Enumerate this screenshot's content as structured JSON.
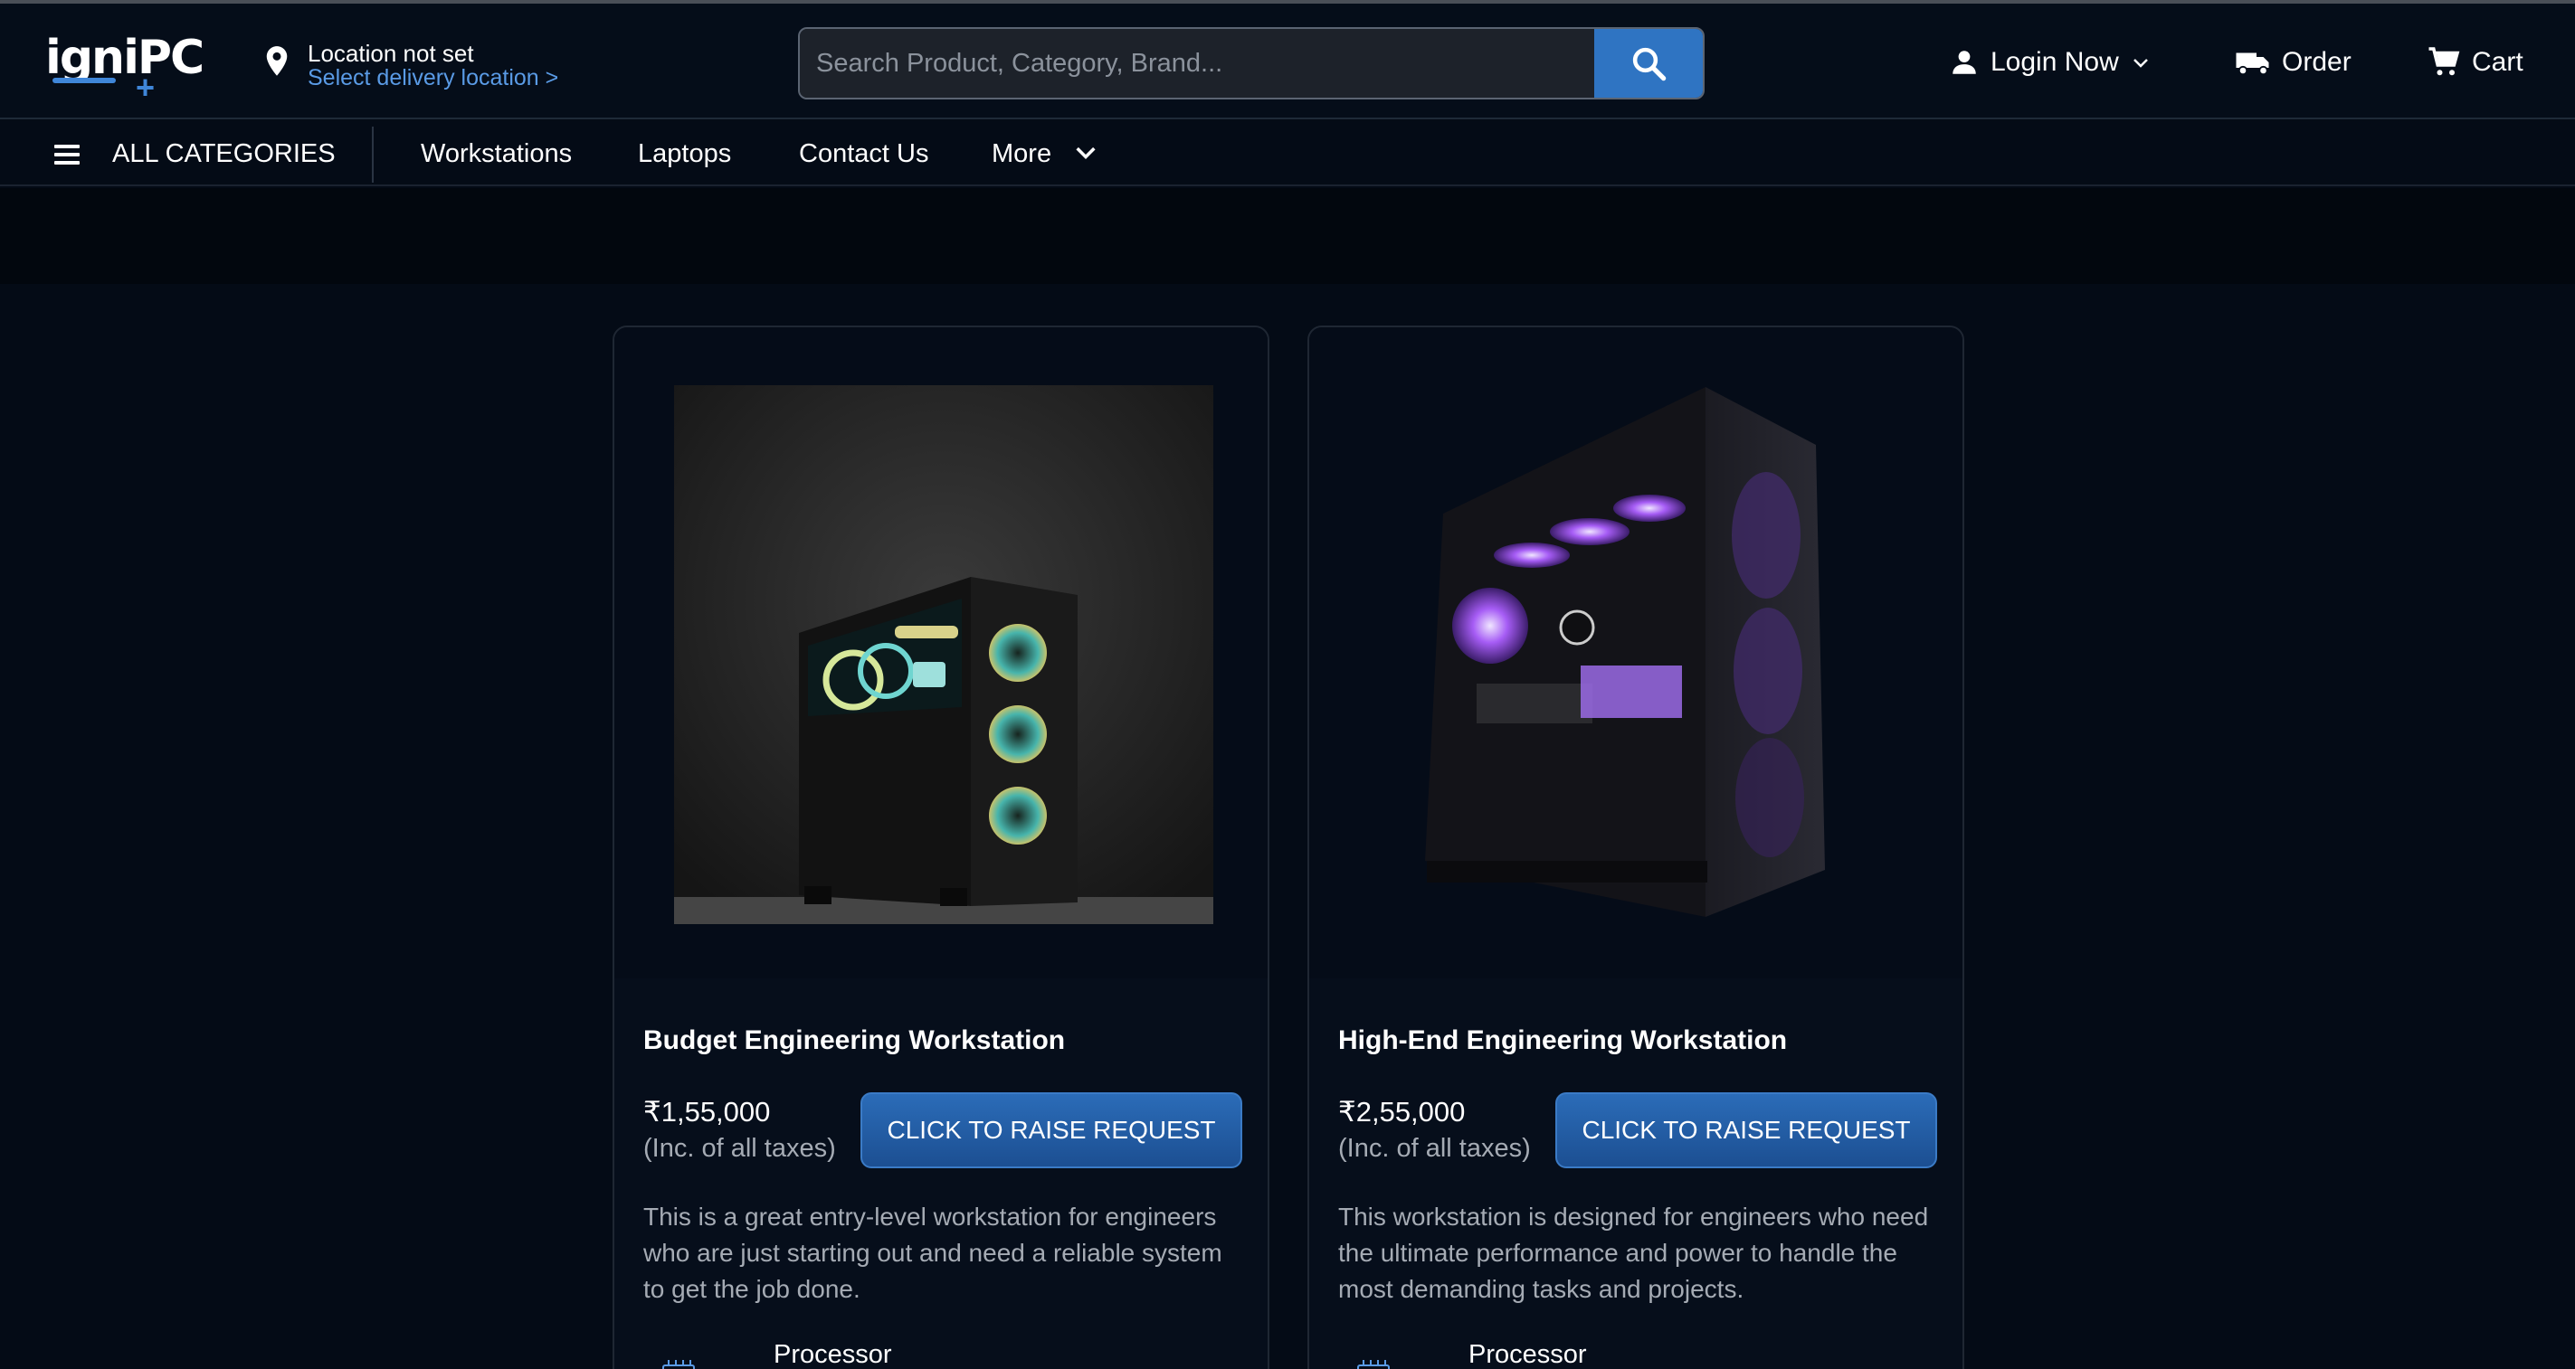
{
  "header": {
    "logo_text": "igniPC",
    "location_title": "Location not set",
    "location_link": "Select delivery location >",
    "search_placeholder": "Search Product, Category, Brand...",
    "login_label": "Login Now",
    "order_label": "Order",
    "cart_label": "Cart"
  },
  "nav": {
    "all_categories": "ALL CATEGORIES",
    "links": [
      "Workstations",
      "Laptops",
      "Contact Us",
      "More"
    ]
  },
  "products": [
    {
      "title": "Budget Engineering Workstation",
      "price": "₹1,55,000",
      "tax_note": "(Inc. of all taxes)",
      "button": "CLICK TO RAISE REQUEST",
      "description": "This is a great entry-level workstation for engineers who are just starting out and need a reliable system to get the job done.",
      "spec_label": "Processor"
    },
    {
      "title": "High-End Engineering Workstation",
      "price": "₹2,55,000",
      "tax_note": "(Inc. of all taxes)",
      "button": "CLICK TO RAISE REQUEST",
      "description": "This workstation is designed for engineers who need the ultimate performance and power to handle the most demanding tasks and projects.",
      "spec_label": "Processor"
    }
  ],
  "colors": {
    "background": "#040b16",
    "accent": "#2f74c2",
    "link": "#5a9be6"
  }
}
